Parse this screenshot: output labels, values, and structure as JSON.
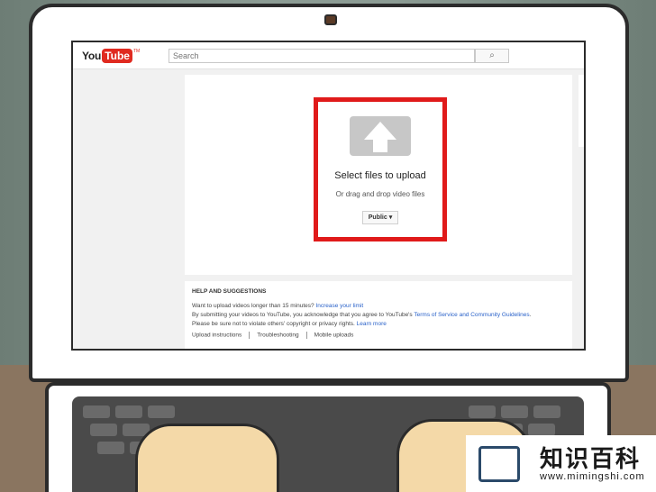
{
  "app": {
    "logo_you": "You",
    "logo_tube": "Tube",
    "logo_tm": "TM"
  },
  "search": {
    "placeholder": "Search",
    "button_icon": "search-icon"
  },
  "upload": {
    "icon": "upload-arrow-icon",
    "title": "Select files to upload",
    "subtitle": "Or drag and drop video files",
    "privacy": "Public",
    "highlight_color": "#e01a1a"
  },
  "help": {
    "heading": "HELP AND SUGGESTIONS",
    "line1_text": "Want to upload videos longer than 15 minutes? ",
    "line1_link": "Increase your limit",
    "line2_text": "By submitting your videos to YouTube, you acknowledge that you agree to YouTube's ",
    "line2_link": "Terms of Service and Community Guidelines",
    "line2_end": ".",
    "line3_text": "Please be sure not to violate others' copyright or privacy rights. ",
    "line3_link": "Learn more",
    "links": [
      "Upload instructions",
      "Troubleshooting",
      "Mobile uploads"
    ]
  },
  "watermark": {
    "title": "知识百科",
    "url": "www.mimingshi.com"
  }
}
